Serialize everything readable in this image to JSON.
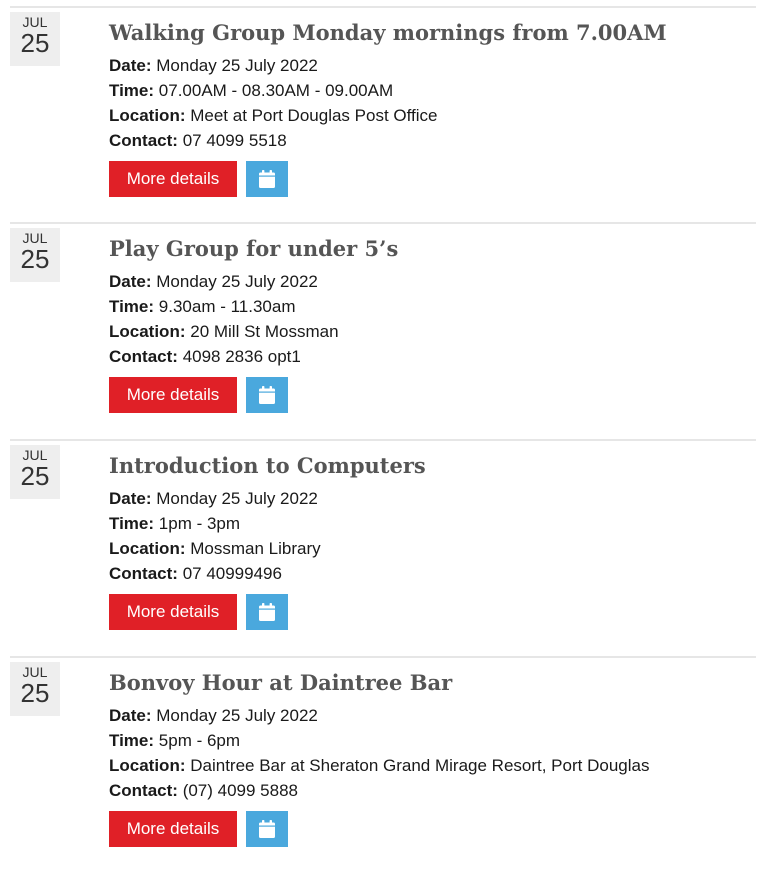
{
  "colors": {
    "button_red": "#e02027",
    "button_blue": "#4aa8dd",
    "title_gray": "#555555"
  },
  "labels": {
    "date": "Date:",
    "time": "Time:",
    "location": "Location:",
    "contact": "Contact:"
  },
  "events": [
    {
      "month": "JUL",
      "day": "25",
      "title": "Walking Group Monday mornings from 7.00AM",
      "date": "Monday 25 July 2022",
      "time": "07.00AM - 08.30AM - 09.00AM",
      "location": "Meet at Port Douglas Post Office",
      "contact": "07 4099 5518",
      "details_label": "More details",
      "calendar_icon": "calendar-icon"
    },
    {
      "month": "JUL",
      "day": "25",
      "title": "Play Group for under 5’s",
      "date": "Monday 25 July 2022",
      "time": "9.30am - 11.30am",
      "location": "20 Mill St Mossman",
      "contact": "4098 2836 opt1",
      "details_label": "More details",
      "calendar_icon": "calendar-icon"
    },
    {
      "month": "JUL",
      "day": "25",
      "title": "Introduction to Computers",
      "date": "Monday 25 July 2022",
      "time": "1pm - 3pm",
      "location": "Mossman Library",
      "contact": "07 40999496",
      "details_label": "More details",
      "calendar_icon": "calendar-icon"
    },
    {
      "month": "JUL",
      "day": "25",
      "title": "Bonvoy Hour at Daintree Bar",
      "date": "Monday 25 July 2022",
      "time": "5pm - 6pm",
      "location": "Daintree Bar at Sheraton Grand Mirage Resort, Port Douglas",
      "contact": "(07) 4099 5888",
      "details_label": "More details",
      "calendar_icon": "calendar-icon"
    }
  ]
}
